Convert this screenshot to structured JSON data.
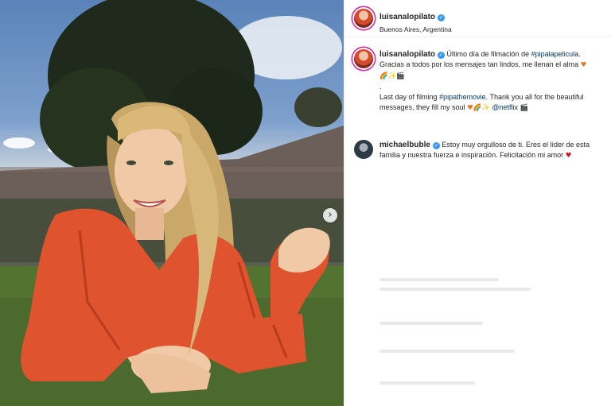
{
  "post": {
    "author": "luisanalopilato",
    "location": "Buenos Aires, Argentina",
    "verified_mark": "✓",
    "next_arrow": "›",
    "caption": {
      "author": "luisanalopilato",
      "es_text": "Último día de filmación de",
      "es_tag": "#pipalapelicula",
      "es_rest": ". Gracias a todos por los mensajes tan lindos, me llenan el alma",
      "dot": ".",
      "en_text": "Last day of filming",
      "en_tag": "#pipathemovie",
      "en_rest": ". Thank you all for the beautiful messages, they fill my soul",
      "mention": "@netflix"
    },
    "comment": {
      "author": "michaelbuble",
      "text": "Estoy muy orgulloso de ti. Eres el líder de esta familia y nuestra fuerza e inspiración. Felicitación mi amor"
    },
    "icons": {
      "heart_orange": "♥",
      "rainbow": "🌈",
      "sparkles": "✨",
      "clapper": "🎬",
      "heart_red": "♥"
    },
    "colors": {
      "jacket": "#e0532f",
      "hashtag": "#00376b",
      "verified": "#3897f0",
      "grass": "#4c6a2d"
    }
  }
}
